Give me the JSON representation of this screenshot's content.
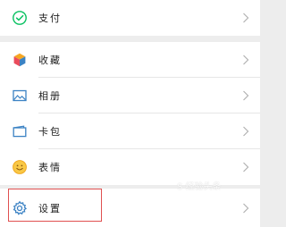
{
  "menu": {
    "payment": {
      "label": "支付",
      "icon": "wechat-pay-icon",
      "color": "#07c160"
    },
    "favorites": {
      "label": "收藏",
      "icon": "favorites-cube-icon",
      "color": "#f5a623"
    },
    "album": {
      "label": "相册",
      "icon": "photo-album-icon",
      "color": "#3b82c4"
    },
    "card_pack": {
      "label": "卡包",
      "icon": "card-wallet-icon",
      "color": "#3b82c4"
    },
    "stickers": {
      "label": "表情",
      "icon": "smiley-face-icon",
      "color": "#f5b025"
    },
    "settings": {
      "label": "设置",
      "icon": "gear-icon",
      "color": "#3b82c4"
    }
  },
  "watermark": {
    "text": "S 经验头条"
  },
  "colors": {
    "background": "#ededed",
    "cell": "#ffffff",
    "highlight": "#e05050",
    "chevron": "#b2b2b2"
  }
}
